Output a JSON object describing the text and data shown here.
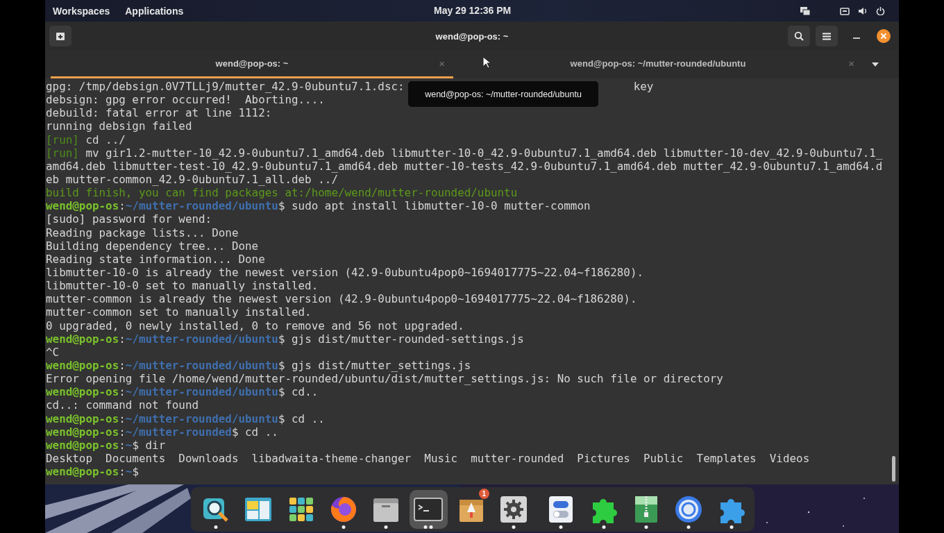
{
  "top_bar": {
    "left": [
      "Workspaces",
      "Applications"
    ],
    "clock": "May 29  12:36 PM"
  },
  "window": {
    "title": "wend@pop-os: ~"
  },
  "tabs": [
    {
      "label": "wend@pop-os: ~",
      "close": "×",
      "selected": true
    },
    {
      "label": "wend@pop-os: ~/mutter-rounded/ubuntu",
      "close": "×",
      "selected": false
    }
  ],
  "tooltip": "wend@pop-os: ~/mutter-rounded/ubuntu",
  "terminal": {
    "lines": [
      [
        {
          "kind": "plain",
          "text": "gpg: /tmp/debsign.0V7TLLj9/mutter_42.9-0ubuntu7.1.dsc:"
        },
        {
          "kind": "plain",
          "text": "key",
          "after_gap": true
        }
      ],
      [
        {
          "kind": "plain",
          "text": "debsign: gpg error occurred!  Aborting...."
        }
      ],
      [
        {
          "kind": "plain",
          "text": "debuild: fatal error at line 1112:"
        }
      ],
      [
        {
          "kind": "plain",
          "text": "running debsign failed"
        }
      ],
      [
        {
          "kind": "run",
          "text": "[run]"
        },
        {
          "kind": "plain",
          "text": " cd ../"
        }
      ],
      [
        {
          "kind": "run",
          "text": "[run]"
        },
        {
          "kind": "plain",
          "text": " mv gir1.2-mutter-10_42.9-0ubuntu7.1_amd64.deb libmutter-10-0_42.9-0ubuntu7.1_amd64.deb libmutter-10-dev_42.9-0ubuntu7.1_"
        }
      ],
      [
        {
          "kind": "plain",
          "text": "amd64.deb libmutter-test-10_42.9-0ubuntu7.1_amd64.deb mutter-10-tests_42.9-0ubuntu7.1_amd64.deb mutter_42.9-0ubuntu7.1_amd64.d"
        }
      ],
      [
        {
          "kind": "plain",
          "text": "eb mutter-common_42.9-0ubuntu7.1_all.deb ../"
        }
      ],
      [
        {
          "kind": "note",
          "text": "build finish, you can find packages at:/home/wend/mutter-rounded/ubuntu"
        }
      ],
      [
        {
          "kind": "user",
          "text": "wend@pop-os"
        },
        {
          "kind": "plain",
          "text": ":"
        },
        {
          "kind": "path",
          "text": "~/mutter-rounded/ubuntu"
        },
        {
          "kind": "plain",
          "text": "$ sudo apt install libmutter-10-0 mutter-common"
        }
      ],
      [
        {
          "kind": "plain",
          "text": "[sudo] password for wend:"
        }
      ],
      [
        {
          "kind": "plain",
          "text": "Reading package lists... Done"
        }
      ],
      [
        {
          "kind": "plain",
          "text": "Building dependency tree... Done"
        }
      ],
      [
        {
          "kind": "plain",
          "text": "Reading state information... Done"
        }
      ],
      [
        {
          "kind": "plain",
          "text": "libmutter-10-0 is already the newest version (42.9-0ubuntu4pop0~1694017775~22.04~f186280)."
        }
      ],
      [
        {
          "kind": "plain",
          "text": "libmutter-10-0 set to manually installed."
        }
      ],
      [
        {
          "kind": "plain",
          "text": "mutter-common is already the newest version (42.9-0ubuntu4pop0~1694017775~22.04~f186280)."
        }
      ],
      [
        {
          "kind": "plain",
          "text": "mutter-common set to manually installed."
        }
      ],
      [
        {
          "kind": "plain",
          "text": "0 upgraded, 0 newly installed, 0 to remove and 56 not upgraded."
        }
      ],
      [
        {
          "kind": "user",
          "text": "wend@pop-os"
        },
        {
          "kind": "plain",
          "text": ":"
        },
        {
          "kind": "path",
          "text": "~/mutter-rounded/ubuntu"
        },
        {
          "kind": "plain",
          "text": "$ gjs dist/mutter-rounded-settings.js"
        }
      ],
      [
        {
          "kind": "plain",
          "text": "^C"
        }
      ],
      [
        {
          "kind": "user",
          "text": "wend@pop-os"
        },
        {
          "kind": "plain",
          "text": ":"
        },
        {
          "kind": "path",
          "text": "~/mutter-rounded/ubuntu"
        },
        {
          "kind": "plain",
          "text": "$ gjs dist/mutter_settings.js"
        }
      ],
      [
        {
          "kind": "plain",
          "text": "Error opening file /home/wend/mutter-rounded/ubuntu/dist/mutter_settings.js: No such file or directory"
        }
      ],
      [
        {
          "kind": "user",
          "text": "wend@pop-os"
        },
        {
          "kind": "plain",
          "text": ":"
        },
        {
          "kind": "path",
          "text": "~/mutter-rounded/ubuntu"
        },
        {
          "kind": "plain",
          "text": "$ cd.."
        }
      ],
      [
        {
          "kind": "plain",
          "text": "cd..: command not found"
        }
      ],
      [
        {
          "kind": "user",
          "text": "wend@pop-os"
        },
        {
          "kind": "plain",
          "text": ":"
        },
        {
          "kind": "path",
          "text": "~/mutter-rounded/ubuntu"
        },
        {
          "kind": "plain",
          "text": "$ cd .."
        }
      ],
      [
        {
          "kind": "user",
          "text": "wend@pop-os"
        },
        {
          "kind": "plain",
          "text": ":"
        },
        {
          "kind": "path",
          "text": "~/mutter-rounded"
        },
        {
          "kind": "plain",
          "text": "$ cd .."
        }
      ],
      [
        {
          "kind": "user",
          "text": "wend@pop-os"
        },
        {
          "kind": "plain",
          "text": ":"
        },
        {
          "kind": "path",
          "text": "~"
        },
        {
          "kind": "plain",
          "text": "$ dir"
        }
      ],
      [
        {
          "kind": "plain",
          "text": "Desktop  Documents  Downloads  libadwaita-theme-changer  Music  mutter-rounded  Pictures  Public  Templates  Videos"
        }
      ],
      [
        {
          "kind": "user",
          "text": "wend@pop-os"
        },
        {
          "kind": "plain",
          "text": ":"
        },
        {
          "kind": "path",
          "text": "~"
        },
        {
          "kind": "plain",
          "text": "$"
        }
      ]
    ]
  },
  "dock": [
    {
      "kind": "search",
      "running": true,
      "multiple": false,
      "selected": false
    },
    {
      "kind": "layout",
      "running": false,
      "selected": false
    },
    {
      "kind": "grid",
      "running": false,
      "selected": false
    },
    {
      "kind": "browser",
      "running": true,
      "multiple": false,
      "selected": false
    },
    {
      "kind": "folder",
      "running": true,
      "multiple": false,
      "selected": false
    },
    {
      "kind": "terminal",
      "running": true,
      "multiple": true,
      "selected": true
    },
    {
      "kind": "package",
      "running": false,
      "selected": false,
      "badge": "1"
    },
    {
      "kind": "gear",
      "running": true,
      "multiple": false,
      "selected": false
    },
    {
      "kind": "toggle",
      "running": true,
      "multiple": false,
      "selected": false
    },
    {
      "kind": "puzzle-green",
      "running": true,
      "multiple": false,
      "selected": false
    },
    {
      "kind": "archive",
      "running": true,
      "multiple": false,
      "selected": false
    },
    {
      "kind": "circle",
      "running": true,
      "multiple": false,
      "selected": false
    },
    {
      "kind": "puzzle-blue",
      "running": true,
      "multiple": false,
      "selected": false
    }
  ]
}
